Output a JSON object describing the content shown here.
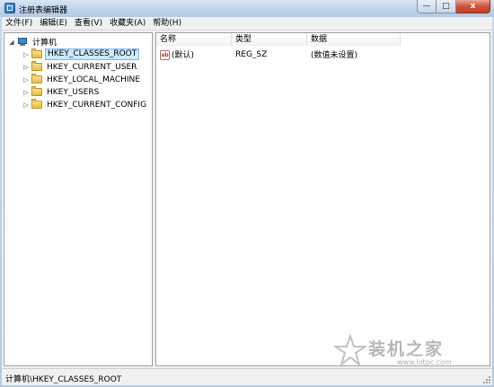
{
  "window": {
    "title": "注册表编辑器",
    "min_glyph": "—",
    "max_glyph": "□",
    "close_glyph": "x"
  },
  "menu": [
    {
      "label": "文件(F)"
    },
    {
      "label": "编辑(E)"
    },
    {
      "label": "查看(V)"
    },
    {
      "label": "收藏夹(A)"
    },
    {
      "label": "帮助(H)"
    }
  ],
  "tree": {
    "root": {
      "label": "计算机",
      "expander": "◢"
    },
    "items": [
      {
        "label": "HKEY_CLASSES_ROOT",
        "selected": true,
        "expander": "▷"
      },
      {
        "label": "HKEY_CURRENT_USER",
        "expander": "▷"
      },
      {
        "label": "HKEY_LOCAL_MACHINE",
        "expander": "▷"
      },
      {
        "label": "HKEY_USERS",
        "expander": "▷"
      },
      {
        "label": "HKEY_CURRENT_CONFIG",
        "expander": "▷"
      }
    ]
  },
  "list": {
    "columns": [
      {
        "label": "名称"
      },
      {
        "label": "类型"
      },
      {
        "label": "数据"
      }
    ],
    "rows": [
      {
        "icon": "reg-string-icon",
        "icon_glyph": "ab",
        "name": "(默认)",
        "type": "REG_SZ",
        "data": "(数值未设置)"
      }
    ]
  },
  "status": {
    "path": "计算机\\HKEY_CLASSES_ROOT"
  },
  "watermark": {
    "title": "装机之家",
    "url": "www.lotpc.com"
  },
  "colors": {
    "accent": "#3a8ad8",
    "selection": "#cde8ff",
    "close": "#c23d26"
  }
}
